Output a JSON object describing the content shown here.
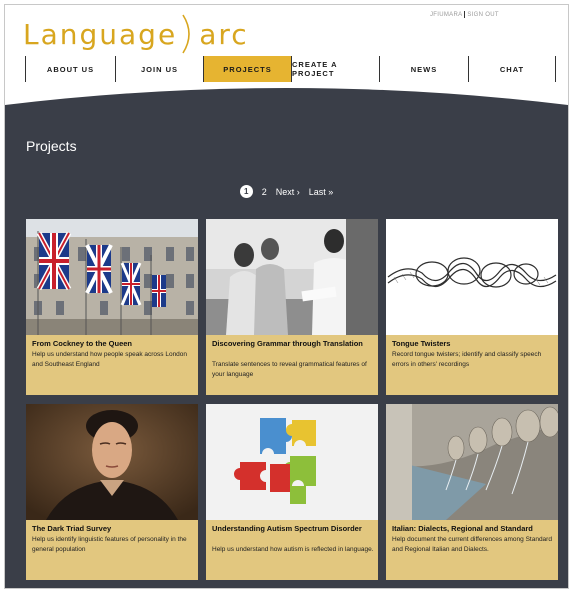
{
  "header": {
    "logo_left": "Language",
    "logo_right": "arc",
    "user_name": "JFIUMARA",
    "sign_out": "SIGN OUT"
  },
  "nav": {
    "items": [
      {
        "label": "ABOUT US"
      },
      {
        "label": "JOIN US"
      },
      {
        "label": "PROJECTS",
        "active": true
      },
      {
        "label": "CREATE A PROJECT"
      },
      {
        "label": "NEWS"
      },
      {
        "label": "CHAT"
      }
    ]
  },
  "main": {
    "title": "Projects",
    "pager": {
      "current": "1",
      "page2": "2",
      "next": "Next ›",
      "last": "Last »"
    },
    "cards": [
      {
        "title": "From Cockney to the Queen",
        "desc": "Help us understand how people speak across London and Southeast England",
        "image": "union-jack-flags-building"
      },
      {
        "title": "Discovering Grammar through Translation",
        "desc": "Translate sentences to reveal grammatical features of your language",
        "image": "field-linguists-photo"
      },
      {
        "title": "Tongue Twisters",
        "desc": "Record tongue twisters; identify and classify speech errors in others' recordings",
        "image": "knotted-rope"
      },
      {
        "title": "The Dark Triad Survey",
        "desc": "Help us identify linguistic features of personality in the general population",
        "image": "machiavelli-portrait"
      },
      {
        "title": "Understanding Autism Spectrum Disorder",
        "desc": "Help us understand how autism is reflected in language.",
        "image": "puzzle-pieces"
      },
      {
        "title": "Italian: Dialects, Regional and Standard",
        "desc": "Help document the current differences among Standard and Regional Italian and Dialects.",
        "image": "fountain-spouts"
      }
    ]
  },
  "colors": {
    "accent": "#e6b431",
    "logo": "#d8a61f",
    "main_bg": "#3a3e48",
    "card_bg": "#e2c77f"
  }
}
